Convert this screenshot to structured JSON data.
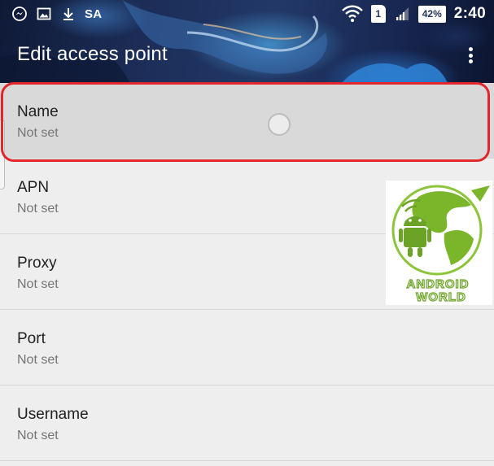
{
  "status_bar": {
    "left_icons": [
      "messenger-icon",
      "gallery-icon",
      "download-icon"
    ],
    "carrier": "SA",
    "sim_slot": "1",
    "battery": "42%",
    "time": "2:40"
  },
  "toolbar": {
    "title": "Edit access point",
    "overflow_icon": "more-vert-icon"
  },
  "fields": [
    {
      "label": "Name",
      "value": "Not set"
    },
    {
      "label": "APN",
      "value": "Not set"
    },
    {
      "label": "Proxy",
      "value": "Not set"
    },
    {
      "label": "Port",
      "value": "Not set"
    },
    {
      "label": "Username",
      "value": "Not set"
    }
  ],
  "watermark": {
    "line1": "ANDROID",
    "line2": "WORLD"
  },
  "colors": {
    "highlight": "#e3262b",
    "watermark_green": "#7ab52a",
    "header_dark": "#1c2d58"
  }
}
